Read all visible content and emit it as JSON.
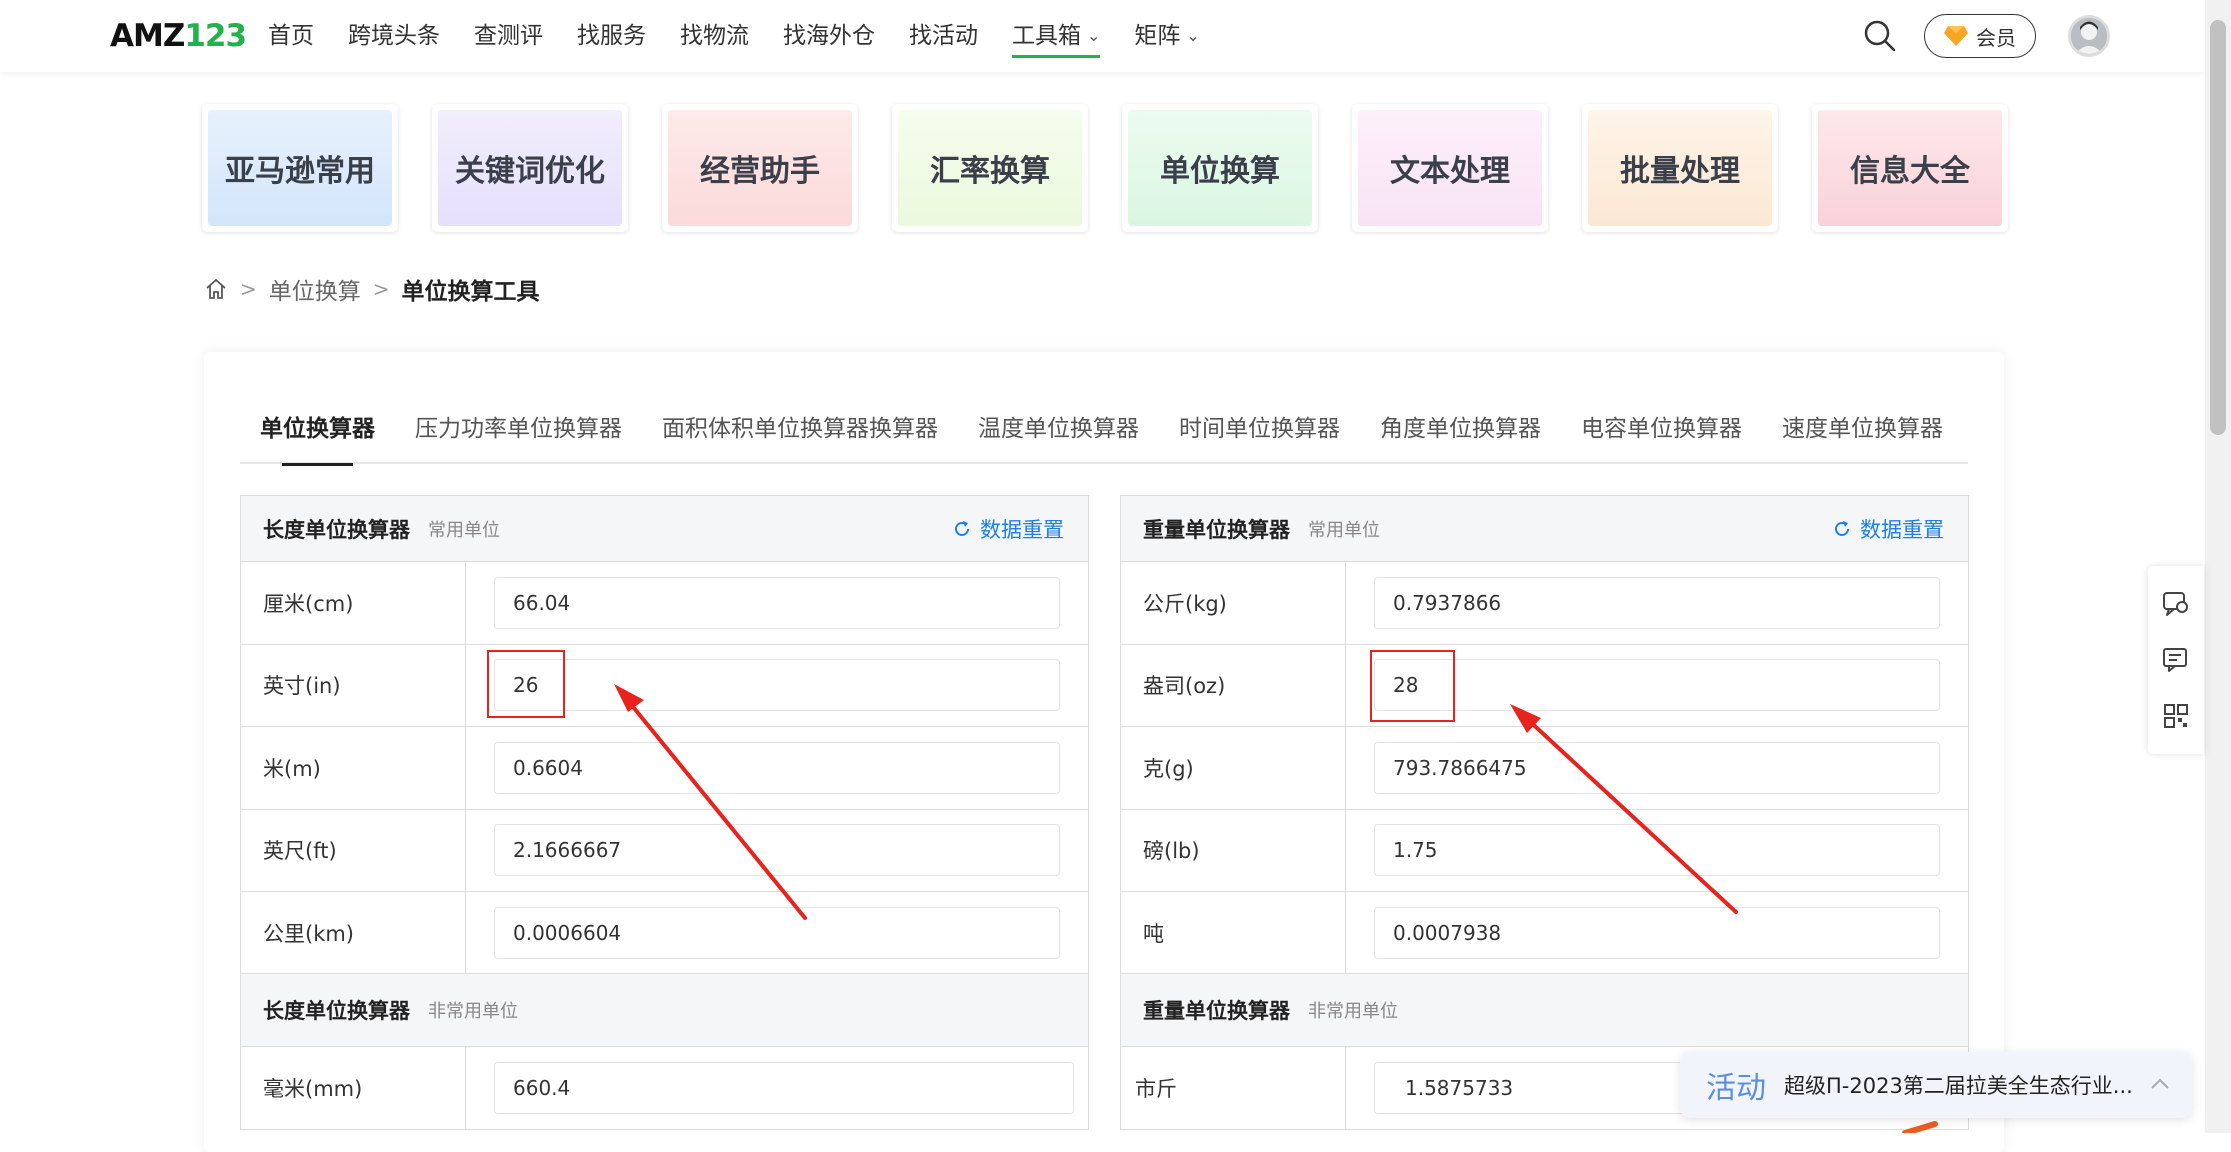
{
  "nav": {
    "logo_main": "AMZ",
    "logo_num": "123",
    "items": [
      {
        "label": "首页"
      },
      {
        "label": "跨境头条"
      },
      {
        "label": "查测评"
      },
      {
        "label": "找服务"
      },
      {
        "label": "找物流"
      },
      {
        "label": "找海外仓"
      },
      {
        "label": "找活动"
      },
      {
        "label": "工具箱"
      },
      {
        "label": "矩阵"
      }
    ],
    "vip_label": "会员"
  },
  "categories": [
    {
      "label": "亚马逊常用",
      "color": "#dcebfb"
    },
    {
      "label": "关键词优化",
      "color": "#ece8fc"
    },
    {
      "label": "经营助手",
      "color": "#fde3e3"
    },
    {
      "label": "汇率换算",
      "color": "#f0fbe6"
    },
    {
      "label": "单位换算",
      "color": "#e4f9ea"
    },
    {
      "label": "文本处理",
      "color": "#fbeaf8"
    },
    {
      "label": "批量处理",
      "color": "#fdefe0"
    },
    {
      "label": "信息大全",
      "color": "#fcdfe3"
    }
  ],
  "breadcrumb": {
    "level1": "单位换算",
    "current": "单位换算工具"
  },
  "tabs": [
    {
      "label": "单位换算器"
    },
    {
      "label": "压力功率单位换算器"
    },
    {
      "label": "面积体积单位换算器换算器"
    },
    {
      "label": "温度单位换算器"
    },
    {
      "label": "时间单位换算器"
    },
    {
      "label": "角度单位换算器"
    },
    {
      "label": "电容单位换算器"
    },
    {
      "label": "速度单位换算器"
    }
  ],
  "length": {
    "title": "长度单位换算器",
    "sub": "常用单位",
    "reset": "数据重置",
    "rows": [
      {
        "label": "厘米(cm)",
        "value": "66.04"
      },
      {
        "label": "英寸(in)",
        "value": "26"
      },
      {
        "label": "米(m)",
        "value": "0.6604"
      },
      {
        "label": "英尺(ft)",
        "value": "2.1666667"
      },
      {
        "label": "公里(km)",
        "value": "0.0006604"
      }
    ],
    "sub2": "非常用单位",
    "low_label": "毫米(mm)",
    "low_value": "660.4"
  },
  "weight": {
    "title": "重量单位换算器",
    "sub": "常用单位",
    "reset": "数据重置",
    "rows": [
      {
        "label": "公斤(kg)",
        "value": "0.7937866"
      },
      {
        "label": "盎司(oz)",
        "value": "28"
      },
      {
        "label": "克(g)",
        "value": "793.7866475"
      },
      {
        "label": "磅(lb)",
        "value": "1.75"
      },
      {
        "label": "吨",
        "value": "0.0007938"
      }
    ],
    "sub2": "非常用单位",
    "low_label": "市斤",
    "low_value": "1.5875733"
  },
  "activity": {
    "tag": "活动",
    "text": "超级Π-2023第二届拉美全生态行业..."
  },
  "colors": {
    "brand_green": "#22b24c",
    "link_blue": "#1e7fe8",
    "annotation_red": "#e8231d"
  }
}
